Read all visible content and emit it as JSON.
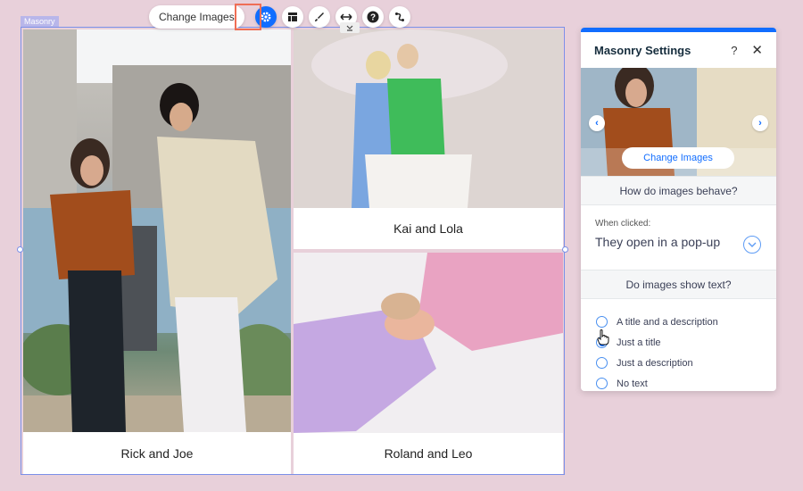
{
  "component_label": "Masonry",
  "toolbar": {
    "change_images_label": "Change Images",
    "icons": [
      "settings-icon",
      "layout-icon",
      "design-brush-icon",
      "stretch-icon",
      "help-icon",
      "animation-icon"
    ]
  },
  "gallery": {
    "items": [
      {
        "caption": "Rick and Joe",
        "photo": "couple-urban-alley"
      },
      {
        "caption": "Kai and Lola",
        "photo": "couple-bubble-studio"
      },
      {
        "caption": "Roland and Leo",
        "photo": "couple-lying-pink"
      }
    ]
  },
  "panel": {
    "title": "Masonry Settings",
    "help_label": "?",
    "close_label": "✕",
    "preview_button_label": "Change Images",
    "prev_arrow": "‹",
    "next_arrow": "›",
    "behave_section": "How do images behave?",
    "when_clicked_label": "When clicked:",
    "when_clicked_value": "They open in a pop-up",
    "text_section": "Do images show text?",
    "text_options": [
      {
        "label": "A title and a description",
        "checked": false
      },
      {
        "label": "Just a title",
        "checked": true
      },
      {
        "label": "Just a description",
        "checked": false
      },
      {
        "label": "No text",
        "checked": false
      }
    ]
  },
  "colors": {
    "accent": "#116dff",
    "background": "#e8d0da",
    "selection_frame": "#7b90e8",
    "active_highlight": "#ef6e55"
  }
}
